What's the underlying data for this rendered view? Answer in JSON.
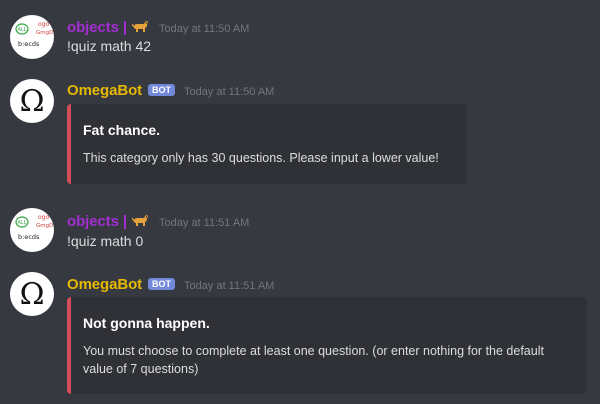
{
  "messages": [
    {
      "author": "objects",
      "author_separator": "|",
      "timestamp": "Today at 11:50 AM",
      "content": "!quiz math 42",
      "avatar_scrawl": [
        "ALL",
        "ogo",
        "GmgD",
        "b:ecds"
      ]
    },
    {
      "author": "OmegaBot",
      "bot_tag": "BOT",
      "timestamp": "Today at 11:50 AM",
      "avatar_glyph": "Ω",
      "embed": {
        "title": "Fat chance.",
        "description": "This category only has 30 questions. Please input a lower value!"
      }
    },
    {
      "author": "objects",
      "author_separator": "|",
      "timestamp": "Today at 11:51 AM",
      "content": "!quiz math 0",
      "avatar_scrawl": [
        "ALL",
        "ogo",
        "GmgD",
        "b:ecds"
      ]
    },
    {
      "author": "OmegaBot",
      "bot_tag": "BOT",
      "timestamp": "Today at 11:51 AM",
      "avatar_glyph": "Ω",
      "embed": {
        "title": "Not gonna happen.",
        "description_line1": "You must choose to complete at least one question. (or enter nothing for the default",
        "description_line2": "value of 7 questions)"
      }
    }
  ],
  "colors": {
    "background": "#36393f",
    "user_name": "#a32ed2",
    "bot_name": "#e6b800",
    "bot_tag": "#7289da",
    "embed_background": "#2f3136",
    "embed_accent": "#d44b5a",
    "timestamp": "#72767d"
  },
  "icons": {
    "user_badge": "dog-icon",
    "user_avatar": "handwritten-scrawl-avatar",
    "bot_avatar": "omega-avatar"
  }
}
